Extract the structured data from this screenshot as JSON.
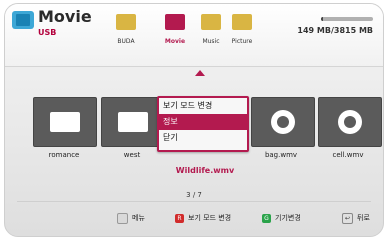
{
  "header": {
    "title": "Movie",
    "source": "USB",
    "tabs": [
      {
        "label": "BUDA",
        "selected": false
      },
      {
        "label": "Movie",
        "selected": true
      },
      {
        "label": "Music",
        "selected": false
      },
      {
        "label": "Picture",
        "selected": false
      }
    ],
    "storage_text": "149 MB/3815 MB",
    "storage_fraction": 0.04
  },
  "files": [
    {
      "label": "romance",
      "type": "folder"
    },
    {
      "label": "west",
      "type": "folder"
    },
    {
      "label": "Wildlife.wmv",
      "type": "video"
    },
    {
      "label": "bag.wmv",
      "type": "video"
    },
    {
      "label": "cell.wmv",
      "type": "video"
    }
  ],
  "selected_file": "Wildlife.wmv",
  "context_menu": {
    "items": [
      {
        "label": "보기 모드 변경",
        "active": false
      },
      {
        "label": "정보",
        "active": true
      },
      {
        "label": "닫기",
        "active": false
      }
    ]
  },
  "pagination": "3 / 7",
  "footer": {
    "menu_label": "메뉴",
    "red_label": "보기 모드 변경",
    "red_key": "R",
    "green_label": "기기변경",
    "green_key": "G",
    "back_label": "뒤로"
  },
  "colors": {
    "accent": "#b31a4f",
    "folder": "#d9b543"
  }
}
